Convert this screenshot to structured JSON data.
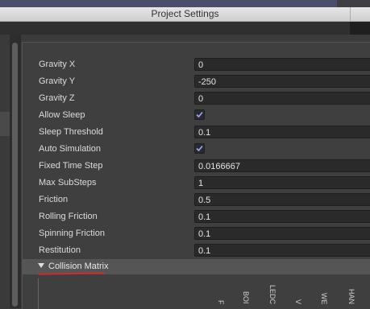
{
  "window": {
    "title": "Project Settings"
  },
  "properties": [
    {
      "label": "Gravity X",
      "type": "number",
      "value": "0"
    },
    {
      "label": "Gravity Y",
      "type": "number",
      "value": "-250"
    },
    {
      "label": "Gravity Z",
      "type": "number",
      "value": "0"
    },
    {
      "label": "Allow Sleep",
      "type": "checkbox",
      "checked": true
    },
    {
      "label": "Sleep Threshold",
      "type": "number",
      "value": "0.1"
    },
    {
      "label": "Auto Simulation",
      "type": "checkbox",
      "checked": true
    },
    {
      "label": "Fixed Time Step",
      "type": "number",
      "value": "0.0166667"
    },
    {
      "label": "Max SubSteps",
      "type": "number",
      "value": "1"
    },
    {
      "label": "Friction",
      "type": "number",
      "value": "0.5"
    },
    {
      "label": "Rolling Friction",
      "type": "number",
      "value": "0.1"
    },
    {
      "label": "Spinning Friction",
      "type": "number",
      "value": "0.1"
    },
    {
      "label": "Restitution",
      "type": "number",
      "value": "0.1"
    }
  ],
  "collision_matrix": {
    "title": "Collision Matrix",
    "expanded": true,
    "columns": [
      "F",
      "BOI",
      "LEDC",
      "V",
      "WE",
      "HAN"
    ]
  },
  "colors": {
    "annotation_underline": "#d02a2a",
    "checkmark": "#9aa6ff"
  }
}
